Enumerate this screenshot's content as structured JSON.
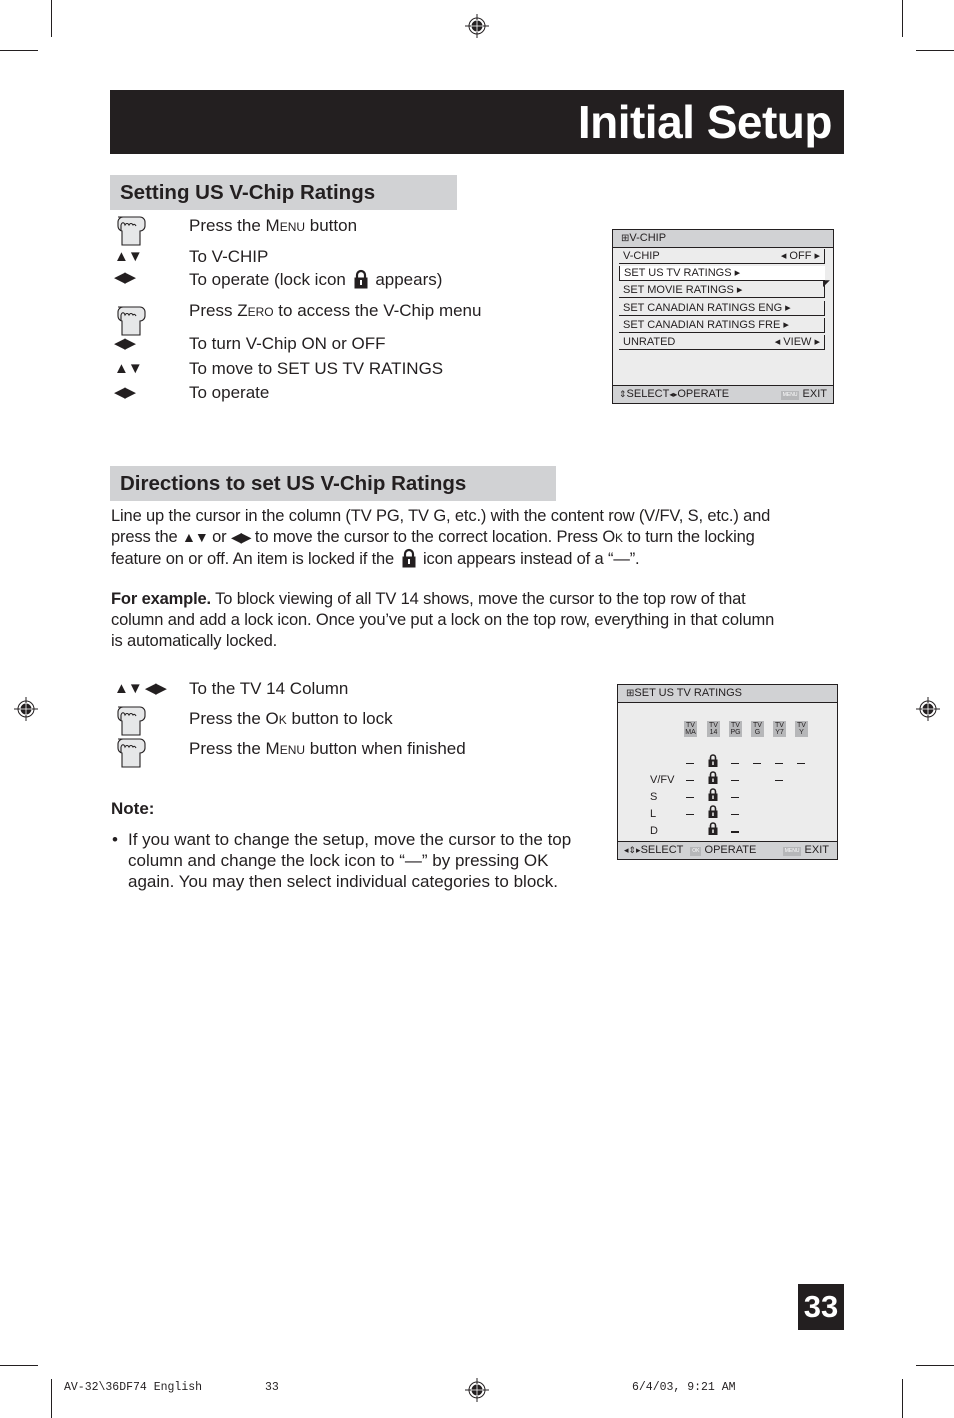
{
  "header": {
    "title": "Initial Setup"
  },
  "section1": {
    "heading": "Setting US V-Chip Ratings",
    "steps": [
      {
        "icon": "hand-press-icon",
        "pre": "Press the ",
        "sc": "Menu",
        "post": " button"
      },
      {
        "icon": "up-down-arrows-icon",
        "text": "To V-CHIP"
      },
      {
        "icon": "left-right-arrows-icon",
        "pre": "To operate (lock icon ",
        "post": " appears)"
      },
      {
        "icon": "hand-press-icon",
        "pre": "Press ",
        "sc": "Zero",
        "post": " to access the V-Chip menu"
      },
      {
        "icon": "left-right-arrows-icon",
        "text": "To turn V-Chip ON or OFF"
      },
      {
        "icon": "up-down-arrows-icon",
        "text": "To move to SET US TV RATINGS"
      },
      {
        "icon": "left-right-arrows-icon",
        "text": "To operate"
      }
    ]
  },
  "vchip_menu": {
    "title": "V-CHIP",
    "rows": [
      {
        "label": "V-CHIP",
        "value": "OFF",
        "selected": false
      },
      {
        "label": "SET US TV RATINGS",
        "selected": true
      },
      {
        "label": "SET MOVIE RATINGS",
        "selected": false
      },
      {
        "label": "SET CANADIAN RATINGS ENG",
        "selected": false
      },
      {
        "label": "SET CANADIAN RATINGS FRE",
        "selected": false
      },
      {
        "label": "UNRATED",
        "value": "VIEW",
        "selected": false
      }
    ],
    "footer": {
      "select": "SELECT",
      "operate": "OPERATE",
      "menu_badge": "MENU",
      "exit": "EXIT"
    }
  },
  "section2": {
    "heading": "Directions to set US V-Chip Ratings",
    "para1": {
      "l1": "Line up the cursor in the column (TV PG, TV G, etc.) with the content row (V/FV, S, etc.) and",
      "l2a": "press the ",
      "l2b": " or ",
      "l2c": " to move the cursor to the correct location. Press O",
      "l2d": "k",
      "l2e": " to turn the locking",
      "l3a": "feature on or off. An item is locked if the ",
      "l3b": " icon appears instead of a “—”."
    },
    "para2": {
      "bold": "For example.",
      "l1": " To block viewing of all TV 14 shows, move the cursor to the top row of that",
      "l2": "column and add a lock icon. Once you’ve put a lock on the top row, everything in that column",
      "l3": "is automatically locked."
    },
    "steps": [
      {
        "icon": "arrows-all-icon",
        "text": "To the TV 14 Column"
      },
      {
        "icon": "hand-press-icon",
        "pre": "Press the ",
        "sc": "Ok",
        "post": " button to lock"
      },
      {
        "icon": "hand-press-icon",
        "pre": "Press the ",
        "sc": "Menu",
        "post": " button when finished"
      }
    ],
    "note": {
      "heading": "Note:",
      "bullet": "•",
      "l1": "If you want to change the setup, move the cursor to the top",
      "l2": "column and change the lock icon to “—” by pressing OK",
      "l3": "again. You may then select individual categories to block."
    }
  },
  "ratings_menu": {
    "title": "SET US TV RATINGS",
    "columns": [
      {
        "top": "TV",
        "bottom": "MA"
      },
      {
        "top": "TV",
        "bottom": "14"
      },
      {
        "top": "TV",
        "bottom": "PG"
      },
      {
        "top": "TV",
        "bottom": "G"
      },
      {
        "top": "TV",
        "bottom": "Y7"
      },
      {
        "top": "TV",
        "bottom": "Y"
      }
    ],
    "rows": [
      {
        "label": "",
        "cells": [
          "dash",
          "lock",
          "dash",
          "dash",
          "dash",
          "dash"
        ]
      },
      {
        "label": "V/FV",
        "cells": [
          "dash",
          "lock",
          "dash",
          "",
          "dash",
          ""
        ]
      },
      {
        "label": "S",
        "cells": [
          "dash",
          "lock",
          "dash",
          "",
          "",
          ""
        ]
      },
      {
        "label": "L",
        "cells": [
          "dash",
          "lock",
          "dash",
          "",
          "",
          ""
        ]
      },
      {
        "label": "D",
        "cells": [
          "",
          "lock",
          "cursor-dash",
          "",
          "",
          ""
        ]
      }
    ],
    "footer": {
      "select": "SELECT",
      "ok_badge": "OK",
      "operate": "OPERATE",
      "menu_badge": "MENU",
      "exit": "EXIT"
    }
  },
  "page_number": "33",
  "slug": {
    "file": "AV-32\\36DF74 English",
    "page": "33",
    "date": "6/4/03, 9:21 AM"
  }
}
